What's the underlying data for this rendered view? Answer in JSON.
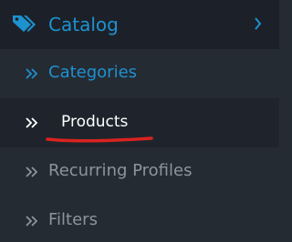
{
  "menu": {
    "header": {
      "label": "Catalog",
      "icon": "tag-icon",
      "expand_icon": "chevron-right-icon"
    },
    "items": [
      {
        "label": "Categories",
        "icon": "double-chevron-icon",
        "state": "active"
      },
      {
        "label": "Products",
        "icon": "double-chevron-icon",
        "state": "highlighted"
      },
      {
        "label": "Recurring Profiles",
        "icon": "double-chevron-icon",
        "state": "default"
      },
      {
        "label": "Filters",
        "icon": "double-chevron-icon",
        "state": "default"
      }
    ]
  },
  "colors": {
    "accent": "#1e91cf",
    "header_bg": "#1c2129",
    "menu_bg": "#252b33",
    "muted_text": "#8d949d",
    "annotation_red": "#d9231f"
  }
}
